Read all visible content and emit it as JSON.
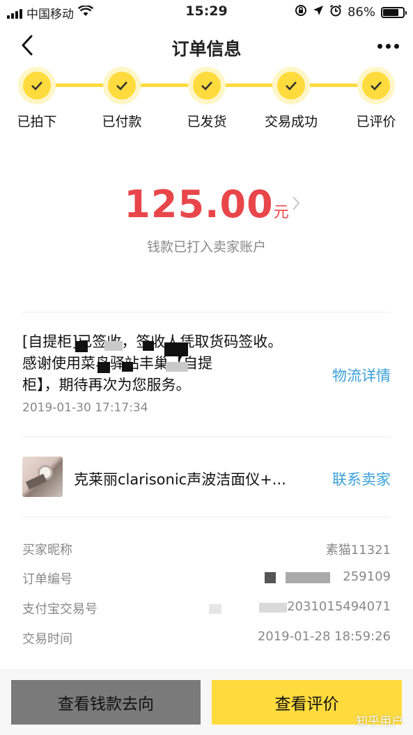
{
  "status_bar": {
    "carrier": "中国移动",
    "time": "15:29",
    "battery": "86%",
    "battery_level": 0.86
  },
  "nav": {
    "title": "订单信息",
    "back_icon": "chevron-left-icon",
    "more_icon": "more-dots-icon"
  },
  "steps": [
    {
      "label": "已拍下",
      "done": true
    },
    {
      "label": "已付款",
      "done": true
    },
    {
      "label": "已发货",
      "done": true
    },
    {
      "label": "交易成功",
      "done": true
    },
    {
      "label": "已评价",
      "done": true
    }
  ],
  "amount": {
    "value": "125.00",
    "unit": "元",
    "note": "钱款已打入卖家账户"
  },
  "logistics": {
    "line1": "[自提柜]已签收，签收人凭取货码签收。",
    "line2": "感谢使用菜鸟驿站丰巢【自提",
    "line3": "柜】，期待再次为您服务。",
    "time": "2019-01-30 17:17:34",
    "link": "物流详情"
  },
  "product": {
    "name": "克莱丽clarisonic声波洁面仪+...",
    "link": "联系卖家"
  },
  "info": [
    {
      "key": "买家昵称",
      "value": "素猫11321"
    },
    {
      "key": "订单编号",
      "value": "259109"
    },
    {
      "key": "支付宝交易号",
      "value": "2031015494071"
    },
    {
      "key": "交易时间",
      "value": "2019-01-28 18:59:26"
    }
  ],
  "buttons": {
    "money_flow": "查看钱款去向",
    "view_review": "查看评价"
  },
  "watermark": "知乎用户",
  "colors": {
    "accent_yellow": "#ffdb3d",
    "amount_red": "#e8464a",
    "link_blue": "#3aa0d8"
  }
}
